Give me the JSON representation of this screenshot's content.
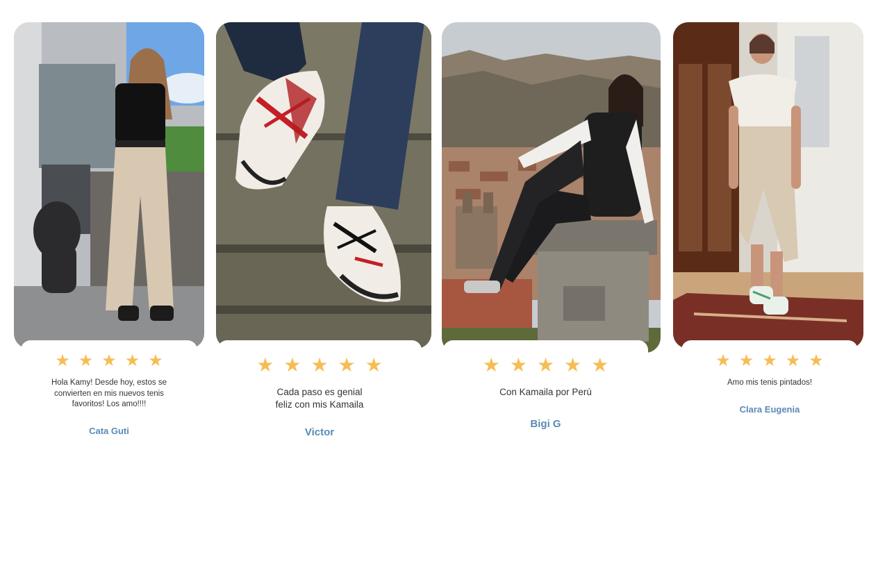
{
  "reviews": [
    {
      "quote": "Hola Kamy! Desde hoy, estos se convierten en mis nuevos tenis favoritos! Los amo!!!!",
      "author": "Cata Guti",
      "rating": 5,
      "photo_icon": "woman-with-dog-photo"
    },
    {
      "quote": "Cada paso es genial feliz con mis Kamaila",
      "author": "Victor",
      "rating": 5,
      "photo_icon": "painted-sneakers-on-stairs-photo"
    },
    {
      "quote": "Con Kamaila por Perú",
      "author": "Bigi G",
      "rating": 5,
      "photo_icon": "woman-sitting-cusco-photo"
    },
    {
      "quote": "Amo mis tenis pintados!",
      "author": "Clara Eugenia",
      "rating": 5,
      "photo_icon": "woman-in-living-room-photo"
    }
  ],
  "star_glyph": "★",
  "colors": {
    "star": "#f6bd54",
    "author": "#5a8ab5",
    "text": "#333333"
  }
}
